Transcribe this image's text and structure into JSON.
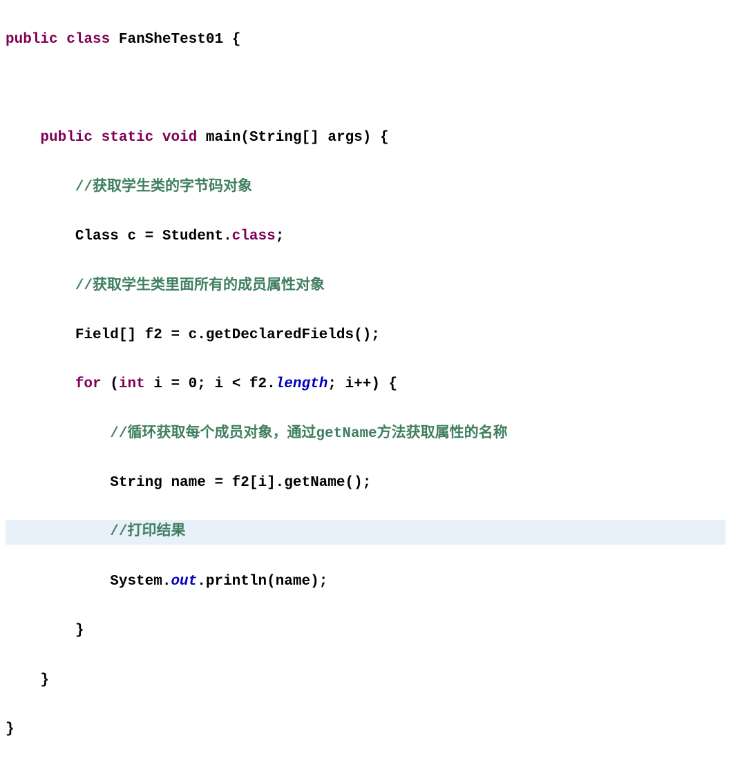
{
  "code": {
    "line1": {
      "kw_public": "public",
      "kw_class": "class",
      "classname": "FanSheTest01",
      "brace": " {"
    },
    "line2": "",
    "line3": {
      "indent": "    ",
      "kw_public": "public",
      "kw_static": "static",
      "kw_void": "void",
      "method": "main",
      "params": "(String[] args) {"
    },
    "line4": {
      "indent": "        ",
      "comment": "//获取学生类的字节码对象"
    },
    "line5": {
      "indent": "        ",
      "text1": "Class c = Student.",
      "kw_class": "class",
      "text2": ";"
    },
    "line6": {
      "indent": "        ",
      "comment": "//获取学生类里面所有的成员属性对象"
    },
    "line7": {
      "indent": "        ",
      "text": "Field[] f2 = c.getDeclaredFields();"
    },
    "line8": {
      "indent": "        ",
      "kw_for": "for",
      "text1": " (",
      "kw_int": "int",
      "text2": " i = 0; i < f2.",
      "field_length": "length",
      "text3": "; i++) {"
    },
    "line9": {
      "indent": "            ",
      "comment": "//循环获取每个成员对象，通过getName方法获取属性的名称"
    },
    "line10": {
      "indent": "            ",
      "text": "String name = f2[i].getName();"
    },
    "line11": {
      "indent": "            ",
      "comment": "//打印结果"
    },
    "line12": {
      "indent": "            ",
      "text1": "System.",
      "field_out": "out",
      "text2": ".println(name);"
    },
    "line13": {
      "indent": "        ",
      "brace": "}"
    },
    "line14": {
      "indent": "    ",
      "brace": "}"
    },
    "line15": {
      "brace": "}"
    }
  }
}
